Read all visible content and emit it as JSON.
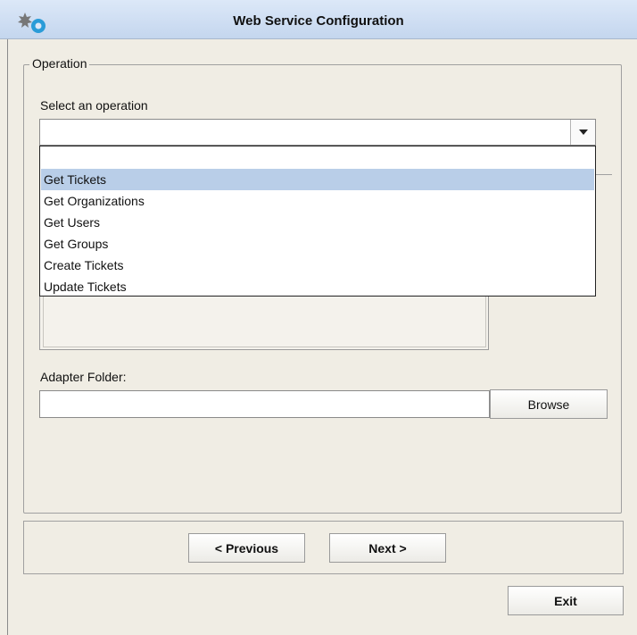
{
  "window": {
    "title": "Web Service Configuration"
  },
  "operation": {
    "group_label": "Operation",
    "select_label": "Select an operation",
    "selected_value": "",
    "options": [
      "",
      "Get Tickets",
      "Get Organizations",
      "Get Users",
      "Get Groups",
      "Create Tickets",
      "Update Tickets"
    ],
    "highlighted_option": "Get Tickets"
  },
  "adapter": {
    "label": "Adapter Folder:",
    "value": "",
    "browse_label": "Browse"
  },
  "navigation": {
    "previous_label": "< Previous",
    "next_label": "Next >",
    "exit_label": "Exit"
  },
  "colors": {
    "titlebar": "#c4d6ee",
    "highlight": "#b9cee8",
    "background": "#f0ede4"
  }
}
